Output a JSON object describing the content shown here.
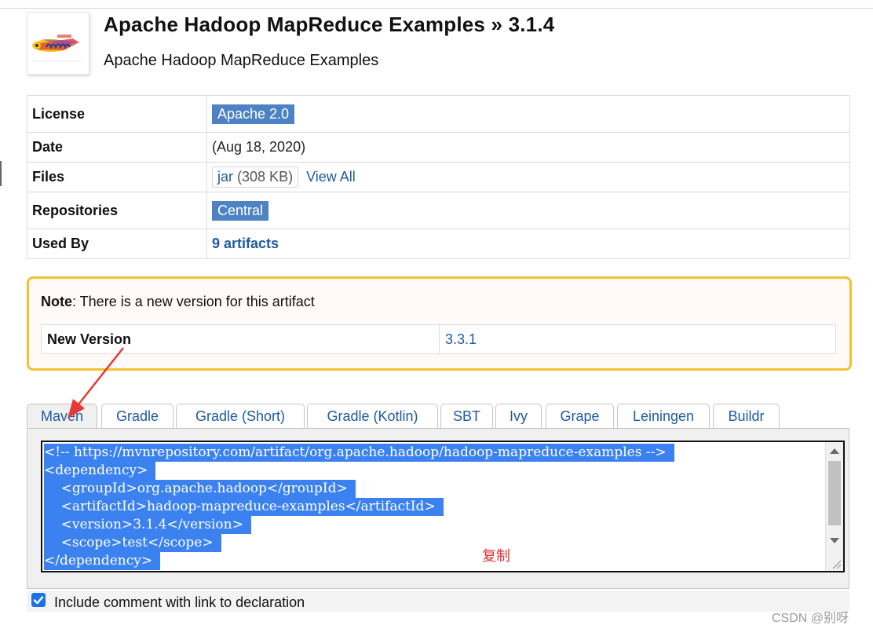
{
  "artifact": {
    "title": "Apache Hadoop MapReduce Examples » 3.1.4",
    "subtitle": "Apache Hadoop MapReduce Examples"
  },
  "info_table": {
    "license_label": "License",
    "license_value": "Apache 2.0",
    "date_label": "Date",
    "date_value": "(Aug 18, 2020)",
    "files_label": "Files",
    "files_jar": "jar",
    "files_size": "(308 KB)",
    "files_view_all": "View All",
    "repos_label": "Repositories",
    "repos_value": "Central",
    "used_by_label": "Used By",
    "used_by_value": "9 artifacts"
  },
  "note": {
    "prefix": "Note",
    "text": ": There is a new version for this artifact",
    "new_version_label": "New Version",
    "new_version_value": "3.3.1"
  },
  "tabs": [
    "Maven",
    "Gradle",
    "Gradle (Short)",
    "Gradle (Kotlin)",
    "SBT",
    "Ivy",
    "Grape",
    "Leiningen",
    "Buildr"
  ],
  "active_tab": "Maven",
  "code_lines": [
    "<!-- https://mvnrepository.com/artifact/org.apache.hadoop/hadoop-mapreduce-examples -->",
    "<dependency>",
    "    <groupId>org.apache.hadoop</groupId>",
    "    <artifactId>hadoop-mapreduce-examples</artifactId>",
    "    <version>3.1.4</version>",
    "    <scope>test</scope>",
    "</dependency>"
  ],
  "annotation": "复制",
  "include_comment": {
    "checked": true,
    "label": "Include comment with link to declaration"
  },
  "watermark": "CSDN @别呀",
  "colors": {
    "badge": "#4d82c3",
    "link": "#1f5aa0",
    "note_border": "#f2c230",
    "selection": "#3b82f0",
    "annotation": "#e0302f"
  },
  "icons": {
    "logo": "hadoop-logo-icon",
    "arrow": "red-arrow-annotation",
    "checkbox": "checkmark-icon"
  }
}
